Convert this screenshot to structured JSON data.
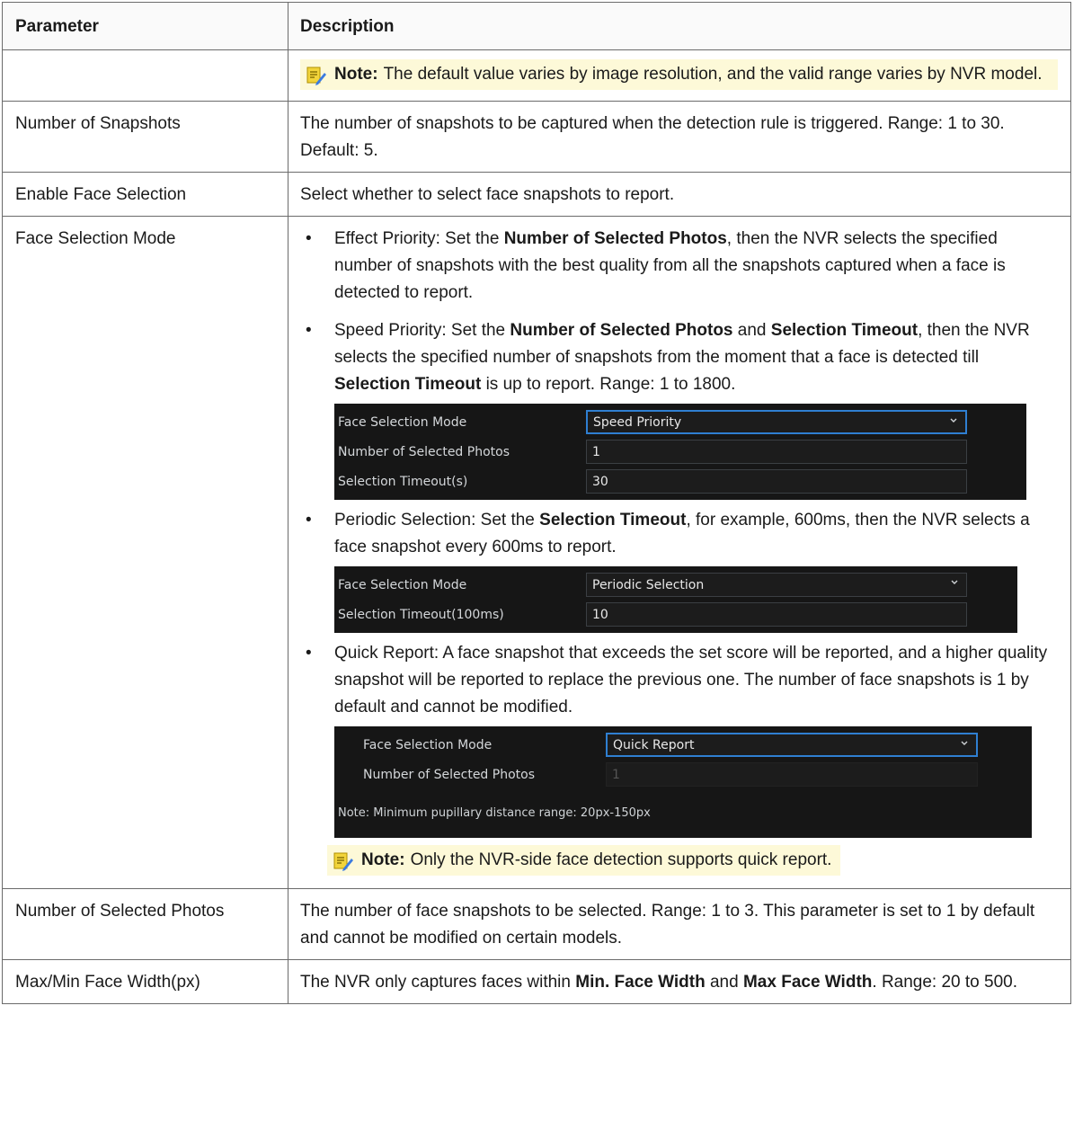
{
  "header": {
    "param": "Parameter",
    "desc": "Description"
  },
  "note_label": "Note:",
  "rows": {
    "r0": {
      "note": "The default value varies by image resolution, and the valid range varies by NVR model."
    },
    "r1": {
      "param": "Number of Snapshots",
      "desc": "The number of snapshots to be captured when the detection rule is triggered. Range: 1 to 30. Default: 5."
    },
    "r2": {
      "param": "Enable Face Selection",
      "desc": "Select whether to select face snapshots to report."
    },
    "r3": {
      "param": "Face Selection Mode",
      "b1": {
        "t1": "Effect Priority: Set the ",
        "b1": "Number of Selected Photos",
        "t2": ", then the NVR selects the specified number of snapshots with the best quality from all the snapshots captured when a face is detected to report."
      },
      "b2": {
        "t1": "Speed Priority: Set the ",
        "b1": "Number of Selected Photos",
        "t2": " and ",
        "b2": "Selection Timeout",
        "t3": ", then the NVR selects the specified number of snapshots from the moment that a face is detected till ",
        "b3": "Selection Timeout",
        "t4": " is up to report. Range: 1 to 1800."
      },
      "ui1": {
        "l1": "Face Selection Mode",
        "v1": "Speed Priority",
        "l2": "Number of Selected Photos",
        "v2": "1",
        "l3": "Selection Timeout(s)",
        "v3": "30"
      },
      "b3": {
        "t1": "Periodic Selection: Set the ",
        "b1": "Selection Timeout",
        "t2": ", for example, 600ms, then the NVR selects a face snapshot every 600ms to report."
      },
      "ui2": {
        "l1": "Face Selection Mode",
        "v1": "Periodic Selection",
        "l2": "Selection Timeout(100ms)",
        "v2": "10"
      },
      "b4": {
        "t1": "Quick Report: A face snapshot that exceeds the set score will be reported, and a higher quality snapshot will be reported to replace the previous one. The number of face snapshots is 1 by default and cannot be modified."
      },
      "ui3": {
        "l1": "Face Selection Mode",
        "v1": "Quick Report",
        "l2": "Number of Selected Photos",
        "v2": "1",
        "note": "Note: Minimum pupillary distance range: 20px-150px"
      },
      "note": "Only the NVR-side face detection supports quick report."
    },
    "r4": {
      "param": "Number of Selected Photos",
      "desc": "The number of face snapshots to be selected. Range: 1 to 3. This parameter is set to 1 by default and cannot be modified on certain models."
    },
    "r5": {
      "param": "Max/Min Face Width(px)",
      "t1": "The NVR only captures faces within ",
      "b1": "Min. Face Width",
      "t2": " and ",
      "b2": "Max Face Width",
      "t3": ". Range: 20 to 500."
    }
  },
  "icons": {
    "note": "note-pencil-icon",
    "dropdown": "chevron-down-icon"
  },
  "colors": {
    "note_bg": "#fdf9d8",
    "panel_bg": "#161616",
    "focus_border": "#2f7fd1"
  }
}
